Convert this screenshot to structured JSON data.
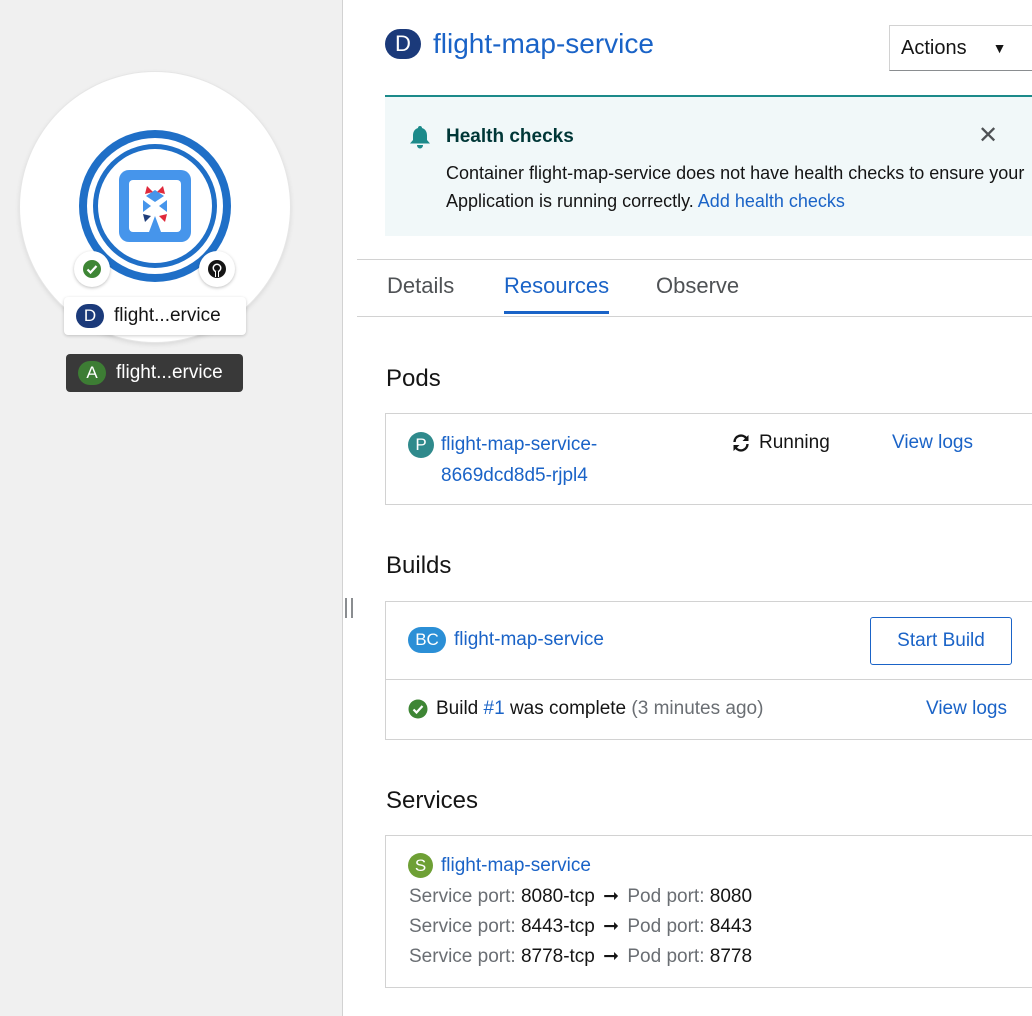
{
  "topology": {
    "node_label": "flight...ervice",
    "node_badge": "D",
    "app_label": "flight...ervice",
    "app_badge": "A"
  },
  "header": {
    "badge": "D",
    "title": "flight-map-service",
    "actions_label": "Actions"
  },
  "alert": {
    "title": "Health checks",
    "body": "Container flight-map-service does not have health checks to ensure your Application is running correctly.",
    "link": "Add health checks"
  },
  "tabs": [
    {
      "label": "Details"
    },
    {
      "label": "Resources"
    },
    {
      "label": "Observe"
    }
  ],
  "pods": {
    "title": "Pods",
    "badge": "P",
    "name_line1": "flight-map-service-",
    "name_line2": "8669dcd8d5-rjpl4",
    "status": "Running",
    "logs": "View logs"
  },
  "builds": {
    "title": "Builds",
    "badge": "BC",
    "name": "flight-map-service",
    "start_button": "Start Build",
    "build_prefix": "Build",
    "build_number": "#1",
    "build_status": "was complete",
    "build_time": "(3 minutes ago)",
    "logs": "View logs"
  },
  "services": {
    "title": "Services",
    "badge": "S",
    "name": "flight-map-service",
    "service_port_label": "Service port:",
    "pod_port_label": "Pod port:",
    "ports": [
      {
        "service": "8080-tcp",
        "pod": "8080"
      },
      {
        "service": "8443-tcp",
        "pod": "8443"
      },
      {
        "service": "8778-tcp",
        "pod": "8778"
      }
    ]
  },
  "colors": {
    "link": "#1a63c7",
    "alert_accent": "#1c8a8a",
    "success": "#3e8635"
  }
}
